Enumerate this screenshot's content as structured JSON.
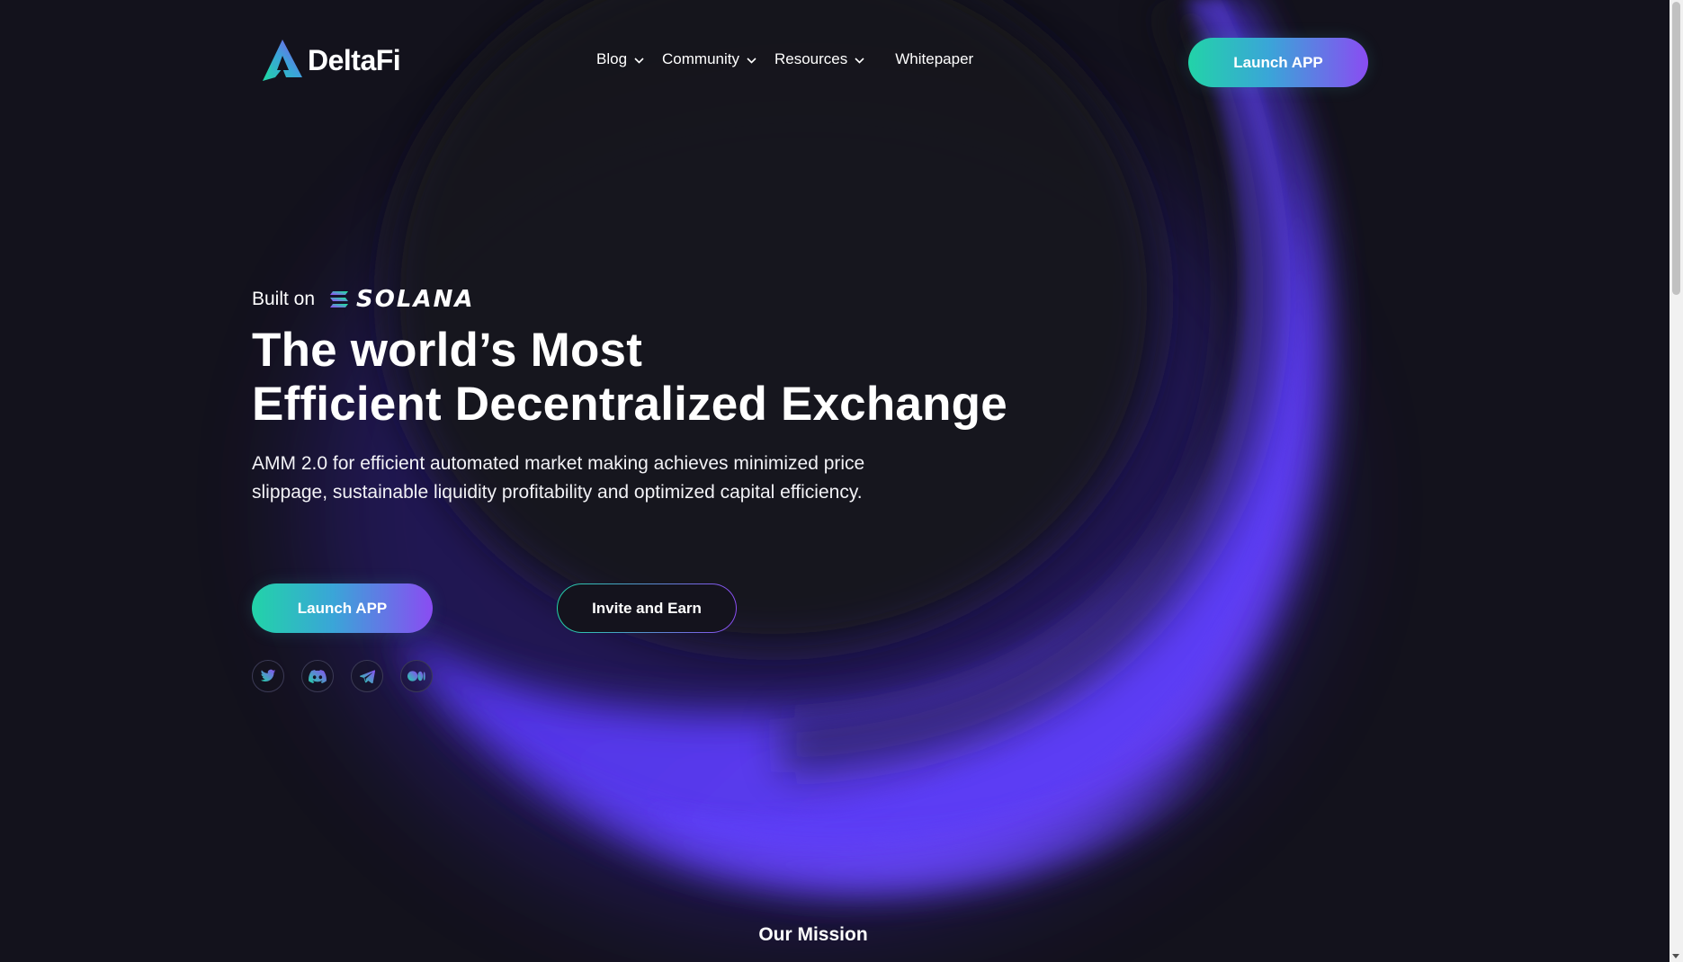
{
  "header": {
    "logo_text": "DeltaFi",
    "nav": {
      "blog": "Blog",
      "community": "Community",
      "resources": "Resources",
      "whitepaper": "Whitepaper"
    },
    "launch_label": "Launch APP"
  },
  "hero": {
    "built_on": "Built on",
    "solana": "SOLANA",
    "title_line1": "The world’s Most",
    "title_line2": "Efficient Decentralized Exchange",
    "description": "AMM 2.0 for efficient automated market making achieves minimized price slippage, sustainable liquidity profitability and optimized capital efficiency.",
    "launch_label": "Launch APP",
    "invite_label": "Invite and Earn",
    "socials": [
      "twitter-icon",
      "discord-icon",
      "telegram-icon",
      "medium-icon"
    ]
  },
  "mission": {
    "title": "Our Mission"
  },
  "colors": {
    "background": "#13121c",
    "gradient_start": "#22d3a8",
    "gradient_end": "#8a4cf2",
    "glow": "#5b3cf5"
  }
}
